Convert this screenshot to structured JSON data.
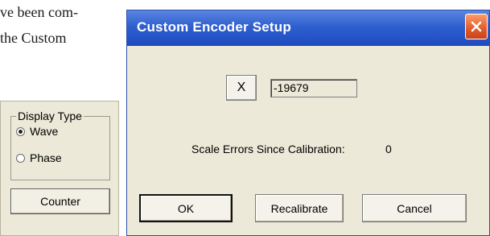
{
  "document": {
    "line1": "ve been com-",
    "line2": "the Custom"
  },
  "display_panel": {
    "group_title": "Display Type",
    "options": [
      {
        "label": "Wave",
        "selected": true
      },
      {
        "label": "Phase",
        "selected": false
      }
    ],
    "counter_label": "Counter"
  },
  "dialog": {
    "title": "Custom Encoder Setup",
    "close_icon": "close-icon",
    "x_button_label": "X",
    "x_value": "-19679",
    "scale_errors_label": "Scale Errors Since Calibration:",
    "scale_errors_value": "0",
    "ok_label": "OK",
    "recalibrate_label": "Recalibrate",
    "cancel_label": "Cancel"
  },
  "colors": {
    "title_bar": "#2f5fcf",
    "close_button": "#e05a2a",
    "dialog_background": "#ece9d8"
  }
}
